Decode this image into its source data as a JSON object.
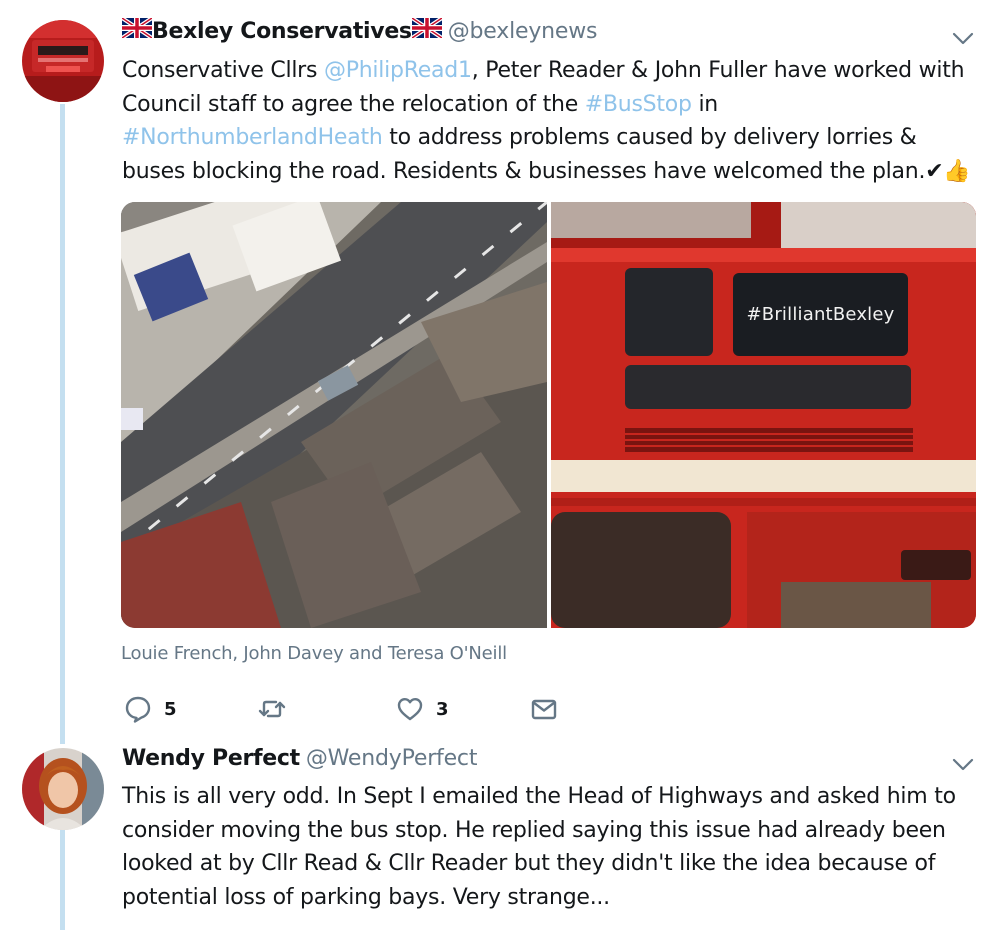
{
  "tweet1": {
    "display_name": "Bexley Conservatives",
    "handle": "@bexleynews",
    "text": {
      "part1": "Conservative Cllrs ",
      "mention": "@PhilipRead1",
      "part2": ", Peter Reader & John Fuller have worked with Council staff to agree the relocation of the ",
      "hashtag1": "#BusStop",
      "part3": " in ",
      "hashtag2": "#NorthumberlandHeath",
      "part4": " to address problems caused by delivery lorries & buses blocking the road. Residents & businesses have welcomed the plan.",
      "emoji": "✔👍"
    },
    "media": {
      "left_image": "aerial-street-photo",
      "right_image": "red-bus-photo",
      "bus_sign_text": "#BrilliantBexley"
    },
    "tagged_people": "Louie French, John Davey and Teresa O'Neill",
    "actions": {
      "reply_count": "5",
      "retweet_count": "",
      "like_count": "3"
    }
  },
  "tweet2": {
    "display_name": "Wendy Perfect",
    "handle": "@WendyPerfect",
    "text": "This is all very odd. In Sept I emailed the Head of Highways and asked him to consider moving the bus stop. He replied saying this issue had already been looked at by Cllr Read & Cllr Reader but they didn't like the idea because of potential loss of parking bays. Very strange..."
  },
  "colors": {
    "link": "#8fc3ea",
    "handle_gray": "#657786",
    "thread_line": "#c4dff0",
    "icon_gray": "#657786"
  }
}
